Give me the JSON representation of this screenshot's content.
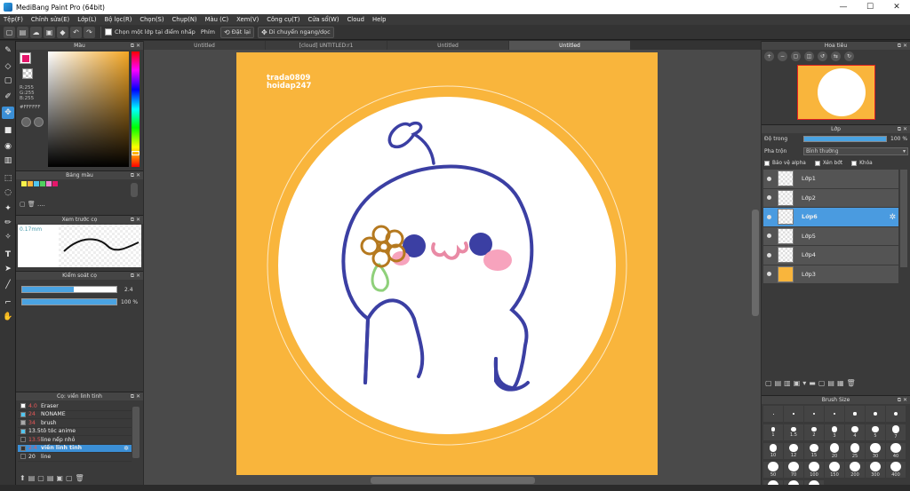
{
  "window": {
    "title": "MediBang Paint Pro (64bit)",
    "minimize": "—",
    "maximize": "☐",
    "close": "✕"
  },
  "menu": [
    "Tệp(F)",
    "Chỉnh sửa(E)",
    "Lớp(L)",
    "Bộ lọc(R)",
    "Chọn(S)",
    "Chụp(N)",
    "Màu (C)",
    "Xem(V)",
    "Công cụ(T)",
    "Cửa sổ(W)",
    "Cloud",
    "Help"
  ],
  "toolbar": {
    "choose_layer_label": "Chọn một lớp tại điểm nhấp",
    "keys_label": "Phím",
    "reset_label": "Đặt lại",
    "move_label": "Di chuyển ngang/dọc"
  },
  "color_panel": {
    "title": "Màu",
    "r": "R:255",
    "g": "G:255",
    "b": "B:255",
    "hex": "#FFFFFF",
    "foreground": "#e6166b"
  },
  "palette_panel": {
    "title": "Bảng màu",
    "colors": [
      "#f9f24a",
      "#f9b53c",
      "#51c6f0",
      "#50d060",
      "#f07fd0",
      "#e6166b"
    ],
    "more": "...."
  },
  "brush_preview": {
    "title": "Xem trước cọ",
    "size": "0.17mm"
  },
  "brush_control": {
    "title": "Kiểm soát cọ",
    "size_value": "2.4",
    "opacity_value": "100 %",
    "size_fraction": 0.55,
    "opacity_fraction": 1.0
  },
  "brush_list": {
    "title": "Cọ: viền linh tinh",
    "items": [
      {
        "size": "4.0",
        "name": "Eraser",
        "red": true,
        "color": "#ffffff"
      },
      {
        "size": "24",
        "name": "NONAME",
        "red": true,
        "color": "#51c6f0"
      },
      {
        "size": "34",
        "name": "brush",
        "red": true,
        "color": "#aaaaaa"
      },
      {
        "size": "13.5",
        "name": "tô tóc anime",
        "red": false,
        "color": "#51c6f0"
      },
      {
        "size": "13.5",
        "name": "line nếp nhỏ",
        "red": true,
        "color": "#333333"
      },
      {
        "size": "2.4",
        "name": "viền linh tinh",
        "red": true,
        "color": "#333333",
        "selected": true
      },
      {
        "size": "20",
        "name": "line",
        "red": false,
        "color": "#333333"
      }
    ]
  },
  "doc_tabs": [
    "Untitled",
    "[cloud] UNTITLED:r1",
    "Untitled",
    "Untitled"
  ],
  "canvas": {
    "watermark_line1": "trada0809",
    "watermark_line2": "hoidap247",
    "bg": "#f9b53c"
  },
  "navigator": {
    "title": "Hoa tiêu"
  },
  "layers": {
    "title": "Lớp",
    "opacity_label": "Độ trong",
    "opacity_value": "100 %",
    "blend_label": "Pha trộn",
    "blend_value": "Bình thường",
    "protect_alpha": "Bảo vệ alpha",
    "clipping": "Xén bớt",
    "lock": "Khóa",
    "items": [
      {
        "name": "Lớp1",
        "selected": false,
        "fill": ""
      },
      {
        "name": "Lớp2",
        "selected": false,
        "fill": ""
      },
      {
        "name": "Lớp6",
        "selected": true,
        "fill": ""
      },
      {
        "name": "Lớp5",
        "selected": false,
        "fill": ""
      },
      {
        "name": "Lớp4",
        "selected": false,
        "fill": ""
      },
      {
        "name": "Lớp3",
        "selected": false,
        "fill": "#f9b53c"
      }
    ]
  },
  "brush_size": {
    "title": "Brush Size",
    "sizes": [
      "",
      "",
      "",
      "",
      "",
      "",
      "",
      "1",
      "1.5",
      "2",
      "3",
      "4",
      "5",
      "7",
      "10",
      "12",
      "15",
      "20",
      "25",
      "30",
      "40",
      "50",
      "70",
      "100",
      "150",
      "200",
      "300",
      "400",
      "500",
      "700",
      "1000"
    ]
  }
}
